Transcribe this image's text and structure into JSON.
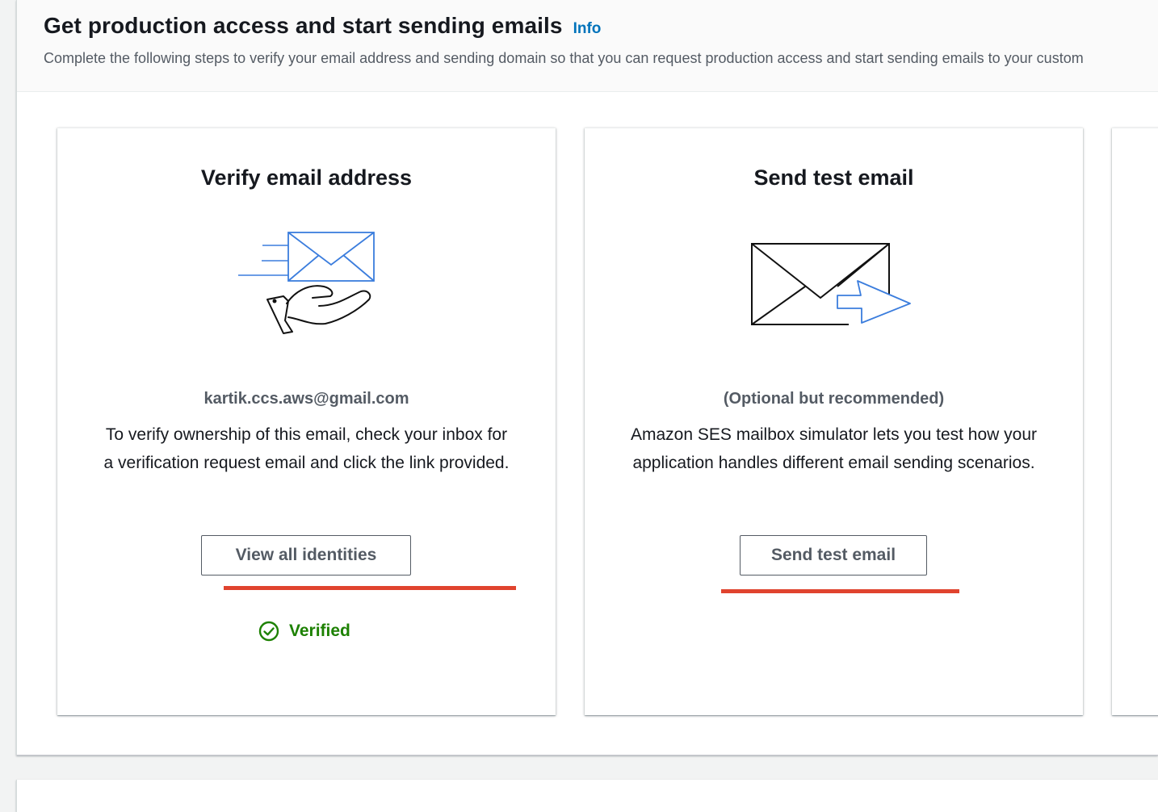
{
  "header": {
    "title": "Get production access and start sending emails",
    "info_link": "Info",
    "description": "Complete the following steps to verify your email address and sending domain so that you can request production access and start sending emails to your custom"
  },
  "cards": [
    {
      "title": "Verify email address",
      "illustration_icon": "email-hand-icon",
      "subtitle": "kartik.ccs.aws@gmail.com",
      "text_line1": "To verify ownership of this email, check your inbox for",
      "text_line2": "a verification request email and click the link provided.",
      "button_label": "View all identities",
      "status_icon": "check-circle-icon",
      "status_label": "Verified"
    },
    {
      "title": "Send test email",
      "illustration_icon": "envelope-arrow-icon",
      "subtitle": "(Optional but recommended)",
      "text_line1": "Amazon SES mailbox simulator lets you test how your",
      "text_line2": "application handles different email sending scenarios.",
      "button_label": "Send test email"
    }
  ],
  "colors": {
    "accent_link": "#0073bb",
    "success": "#1d8102",
    "annotation_underline": "#e0432e",
    "illustration_blue": "#3b7ddd"
  }
}
